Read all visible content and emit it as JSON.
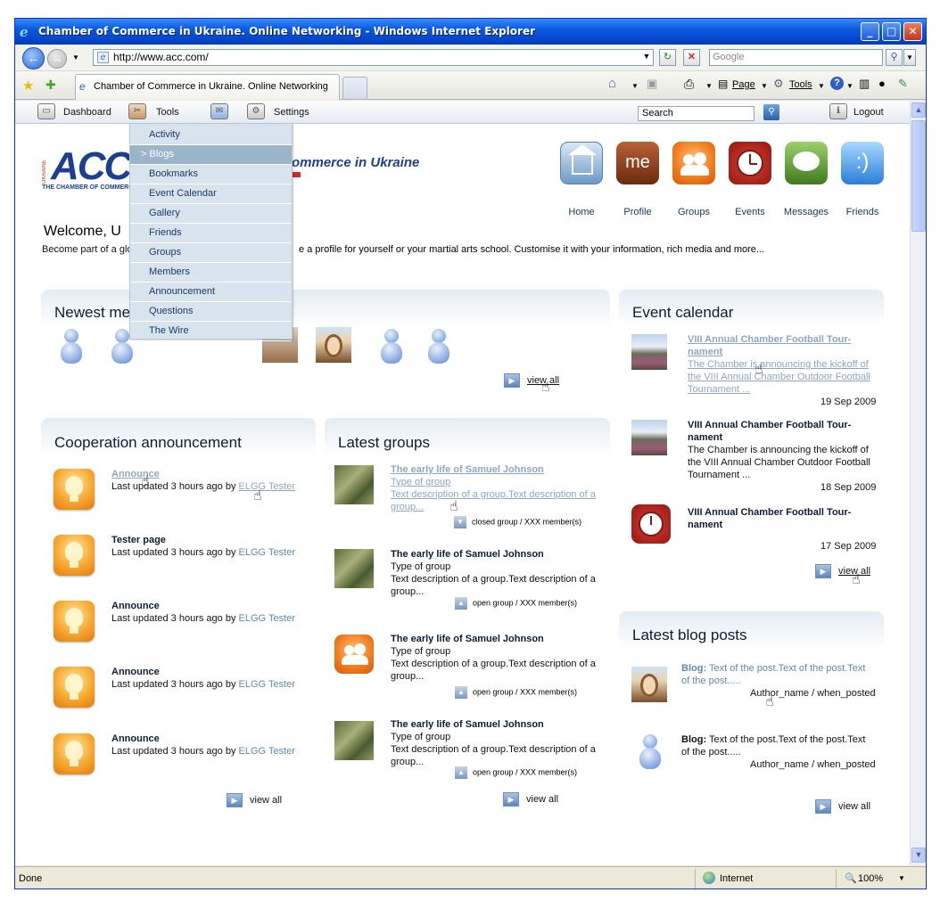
{
  "window": {
    "title": "Chamber of Commerce in Ukraine. Online Networking  - Windows Internet Explorer",
    "url": "http://www.acc.com/",
    "search_placeholder": "Google",
    "tab_title": "Chamber of Commerce in Ukraine. Online Networking",
    "cmd": {
      "page": "Page",
      "tools": "Tools"
    },
    "status": {
      "left": "Done",
      "zone": "Internet",
      "zoom": "100%"
    }
  },
  "topnav": {
    "dashboard": "Dashboard",
    "tools": "Tools",
    "settings": "Settings",
    "search_placeholder": "Search",
    "logout": "Logout"
  },
  "dropdown": {
    "items": [
      "Activity",
      "> Blogs",
      "Bookmarks",
      "Event Calendar",
      "Gallery",
      "Friends",
      "Groups",
      "Members",
      "Announcement",
      "Questions",
      "The Wire"
    ],
    "active_index": 1
  },
  "header": {
    "logo_text": "ACC",
    "logo_small": "THE CHAMBER OF COMMERCE",
    "logo_vertical": "UKRAINE",
    "site_title": "ommerce in Ukraine",
    "welcome": "Welcome, U",
    "welcome_sub_left": "Become part of a glo",
    "welcome_sub_right": "e a profile for yourself or your martial arts school. Customise it with your information, rich media and more..."
  },
  "apps": [
    {
      "label": "Home",
      "color": "#6d99c9",
      "icon": "home-icon"
    },
    {
      "label": "Profile",
      "color": "#8a3a14",
      "icon": "me-icon",
      "text": "me"
    },
    {
      "label": "Groups",
      "color": "#f07a1a",
      "icon": "groups-icon"
    },
    {
      "label": "Events",
      "color": "#b5251b",
      "icon": "clock-icon"
    },
    {
      "label": "Messages",
      "color": "#4f8b2a",
      "icon": "speech-bubble-icon"
    },
    {
      "label": "Friends",
      "color": "#3a8fe0",
      "icon": "smiley-icon",
      "text": ":)"
    }
  ],
  "newest_members": {
    "title": "Newest me",
    "view_all": "view all"
  },
  "cooperation": {
    "title": "Cooperation announcement",
    "items": [
      {
        "title": "Announce",
        "meta": "Last updated 3 hours ago by",
        "author": "ELGG Tester",
        "link": true
      },
      {
        "title": "Tester page",
        "meta": "Last updated 3 hours ago by",
        "author": "ELGG Tester",
        "link": false
      },
      {
        "title": "Announce",
        "meta": "Last updated 3 hours ago by",
        "author": "ELGG Tester",
        "link": false
      },
      {
        "title": "Announce",
        "meta": "Last updated 3 hours ago by",
        "author": "ELGG Tester",
        "link": false
      },
      {
        "title": "Announce",
        "meta": "Last updated 3 hours ago by",
        "author": "ELGG Tester",
        "link": false
      }
    ],
    "view_all": "view all"
  },
  "groups": {
    "title": "Latest groups",
    "items": [
      {
        "title": "The early life of Samuel Johnson",
        "type": "Type of group",
        "desc1": "Text description of a group.Text description of a",
        "desc2": "group...",
        "status": "closed group / XXX member(s)",
        "link": true
      },
      {
        "title": "The early life of Samuel Johnson",
        "type": "Type of group",
        "desc1": "Text description of a group.Text description of a",
        "desc2": "group...",
        "status": "open group / XXX member(s)",
        "link": false
      },
      {
        "title": "The early life of Samuel Johnson",
        "type": "Type of group",
        "desc1": "Text description of a group.Text description of a",
        "desc2": "group...",
        "status": "open group / XXX member(s)",
        "link": false
      },
      {
        "title": "The early life of Samuel Johnson",
        "type": "Type of group",
        "desc1": "Text description of a group.Text description of a",
        "desc2": "group...",
        "status": "open group / XXX member(s)",
        "link": false
      }
    ],
    "view_all": "view all"
  },
  "events": {
    "title": "Event calendar",
    "items": [
      {
        "title1": "VIII Annual Chamber Football Tour-",
        "title2": "nament",
        "d1": "The Chamber is announcing the kickoff of",
        "d2": "the VIII Annual Chamber Outdoor Football",
        "d3": "Tournament ...",
        "date": "19 Sep 2009",
        "link": true
      },
      {
        "title1": "VIII Annual Chamber Football Tour-",
        "title2": "nament",
        "d1": "The Chamber is announcing the kickoff of",
        "d2": "the VIII Annual Chamber Outdoor Football",
        "d3": "Tournament ...",
        "date": "18 Sep 2009",
        "link": false
      },
      {
        "title1": "VIII Annual Chamber Football Tour-",
        "title2": "nament",
        "date": "17 Sep 2009",
        "link": false
      }
    ],
    "view_all": "view all"
  },
  "blog": {
    "title": "Latest blog posts",
    "items": [
      {
        "label": "Blog:",
        "text1": "Text of the post.Text of the post.Text",
        "text2": "of the post.....",
        "author": "Author_name / when_posted",
        "link": true
      },
      {
        "label": "Blog:",
        "text1": "Text of the post.Text of the post.Text",
        "text2": "of the post.....",
        "author": "Author_name / when_posted",
        "link": false
      }
    ],
    "view_all": "view all"
  }
}
